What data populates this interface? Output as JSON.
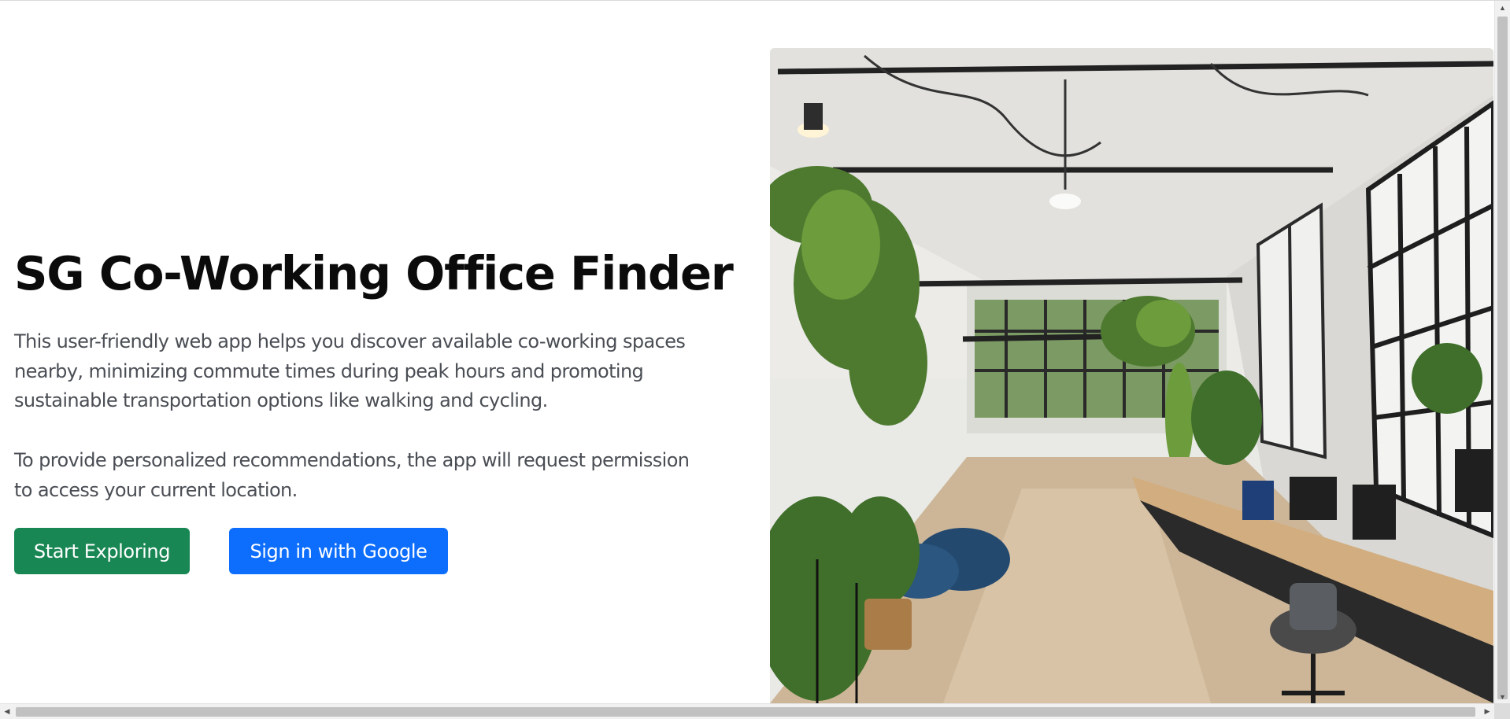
{
  "hero": {
    "title": "SG Co-Working Office Finder",
    "description": "This user-friendly web app helps you discover available co-working spaces nearby, minimizing commute times during peak hours and promoting sustainable transportation options like walking and cycling.",
    "location_note": "To provide personalized recommendations, the app will request permission to access your current location.",
    "buttons": {
      "explore_label": "Start Exploring",
      "google_label": "Sign in with Google"
    },
    "image_alt": "Co-working office interior with plants"
  },
  "colors": {
    "explore_button": "#198754",
    "google_button": "#0d6efd",
    "title_text": "#0b0b0b",
    "body_text": "#4a4e54"
  },
  "icons": {
    "scroll_up": "triangle-up",
    "scroll_down": "triangle-down",
    "scroll_left": "triangle-left",
    "scroll_right": "triangle-right"
  }
}
